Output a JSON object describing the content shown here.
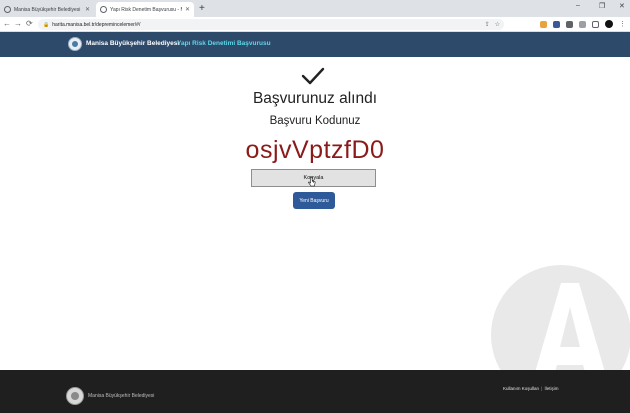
{
  "browser": {
    "tabs": [
      {
        "title": "Manisa Büyükşehir Belediyesi",
        "active": false
      },
      {
        "title": "Yapı Risk Denetim Başvurusu - M",
        "active": true
      }
    ],
    "new_tab_glyph": "+",
    "window_controls": [
      "–",
      "❐",
      "✕"
    ],
    "address": {
      "url": "harita.manisa.bel.tr/depremincelemer/#/"
    },
    "nav": {
      "back": "←",
      "forward": "→",
      "reload": "⟳"
    }
  },
  "header": {
    "brand": "Manisa Büyükşehir Belediyesi",
    "app_title": "Yapı Risk Denetimi Başvurusu",
    "bg_color": "#2e4a6b",
    "title_color": "#5fd7e8"
  },
  "main": {
    "heading": "Başvurunuz alındı",
    "subheading": "Başvuru Kodunuz",
    "code": "osjvVptzfD0",
    "code_color": "#8b1a1a",
    "copy_button": "Kopyala",
    "new_button": "Yeni Başvuru"
  },
  "footer": {
    "brand": "Manisa Büyükşehir Belediyesi",
    "links": [
      "Kullanım Koşulları",
      "İletişim"
    ],
    "separator": "|"
  }
}
